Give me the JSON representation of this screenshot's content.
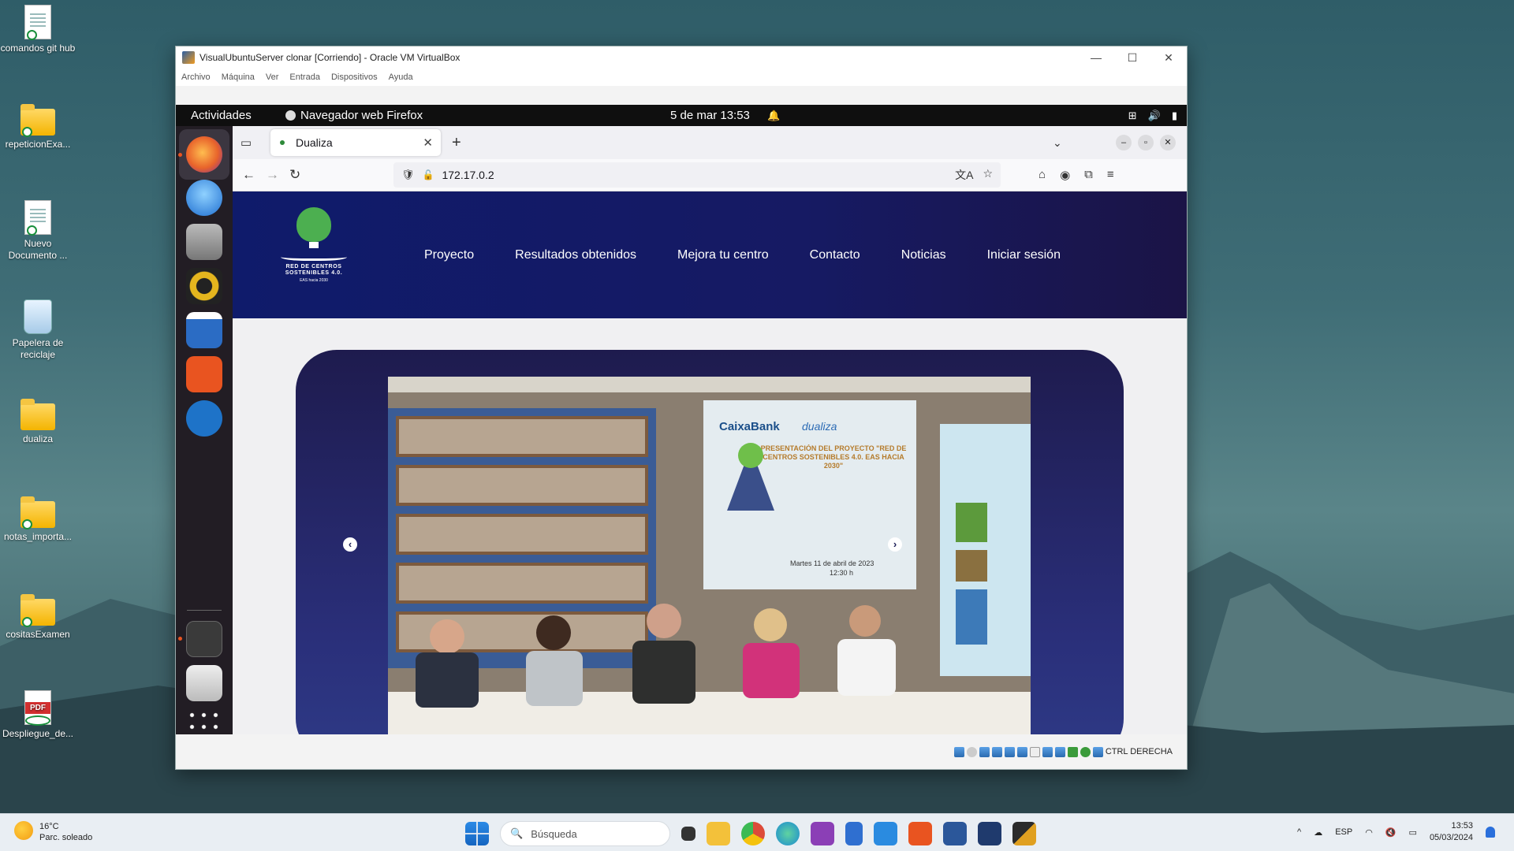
{
  "desktop": {
    "icons": [
      {
        "label": "comandos git hub",
        "type": "document"
      },
      {
        "label": "repeticionExa...",
        "type": "folder"
      },
      {
        "label": "Nuevo Documento ...",
        "type": "document"
      },
      {
        "label": "Papelera de reciclaje",
        "type": "recycle-bin"
      },
      {
        "label": "dualiza",
        "type": "folder"
      },
      {
        "label": "notas_importa...",
        "type": "folder"
      },
      {
        "label": "cositasExamen",
        "type": "folder"
      },
      {
        "label": "Despliegue_de...",
        "type": "pdf"
      }
    ],
    "pdf_badge": "PDF"
  },
  "vbox": {
    "title": "VisualUbuntuServer clonar [Corriendo] - Oracle VM VirtualBox",
    "controls": {
      "minimize": "—",
      "maximize": "☐",
      "close": "✕"
    },
    "menu": [
      "Archivo",
      "Máquina",
      "Ver",
      "Entrada",
      "Dispositivos",
      "Ayuda"
    ],
    "host_key": "CTRL DERECHA"
  },
  "gnome": {
    "activities": "Actividades",
    "app_name": "Navegador web Firefox",
    "clock": "5 de mar  13:53",
    "icons": {
      "bell": "🔔",
      "network": "⊞",
      "volume": "🔊",
      "battery": "▮"
    }
  },
  "dock": {
    "apps": [
      {
        "name": "firefox",
        "color": "#e8632b",
        "active": true
      },
      {
        "name": "thunderbird",
        "color": "#1f6fd1",
        "active": false
      },
      {
        "name": "files",
        "color": "#9a9a9a",
        "active": false
      },
      {
        "name": "rhythmbox",
        "color": "#e4b51e",
        "active": false
      },
      {
        "name": "libreoffice-writer",
        "color": "#2b6cc4",
        "active": false
      },
      {
        "name": "app-center",
        "color": "#e95420",
        "active": false
      },
      {
        "name": "help",
        "color": "#1e73c8",
        "active": false
      },
      {
        "name": "terminal",
        "color": "#3a3a3a",
        "active": true
      },
      {
        "name": "trash",
        "color": "#d8d8d8",
        "active": false
      }
    ]
  },
  "firefox": {
    "tab_title": "Dualiza",
    "tab_close": "✕",
    "new_tab": "+",
    "tab_list": "⌄",
    "url": "172.17.0.2",
    "nav": {
      "back": "←",
      "forward": "→",
      "reload": "↻"
    },
    "icons": {
      "shield": "🛡",
      "lock": "🔓",
      "translate": "文A",
      "star": "☆",
      "pocket": "⌂",
      "account": "◉",
      "extensions": "⧉",
      "menu": "≡"
    }
  },
  "site": {
    "logo": {
      "line1": "RED DE CENTROS",
      "line2": "SOSTENIBLES 4.0.",
      "line3": "EAS hacia 2030"
    },
    "nav": [
      "Proyecto",
      "Resultados obtenidos",
      "Mejora tu centro",
      "Contacto",
      "Noticias",
      "Iniciar sesión"
    ],
    "slide": {
      "banner_brand_1": "CaixaBank",
      "banner_brand_2": "dualiza",
      "banner_title": "PRESENTACIÓN DEL PROYECTO \"RED DE CENTROS SOSTENIBLES 4.0. EAS HACIA 2030\"",
      "banner_date": "Martes 11 de abril de 2023",
      "banner_time": "12:30 h"
    },
    "prev_arrow": "‹",
    "next_arrow": "›"
  },
  "taskbar": {
    "weather": {
      "temp": "16°C",
      "desc": "Parc. soleado"
    },
    "search_placeholder": "Búsqueda",
    "apps": [
      {
        "name": "task-view",
        "color": "#333"
      },
      {
        "name": "file-explorer",
        "color": "#f3c13a"
      },
      {
        "name": "chrome",
        "color": "#dd4b39"
      },
      {
        "name": "edge",
        "color": "#1b8ad3"
      },
      {
        "name": "app-purple",
        "color": "#8b3fb6"
      },
      {
        "name": "notepad",
        "color": "#2f6fd0"
      },
      {
        "name": "vscode",
        "color": "#2a8be0"
      },
      {
        "name": "ubuntu-app",
        "color": "#e95420"
      },
      {
        "name": "word",
        "color": "#2b579a"
      },
      {
        "name": "virtualbox",
        "color": "#1f3a6d"
      },
      {
        "name": "app-dark",
        "color": "#2b2b2b"
      }
    ],
    "lang": "ESP",
    "time": "13:53",
    "date": "05/03/2024",
    "tray_chevron": "^"
  }
}
